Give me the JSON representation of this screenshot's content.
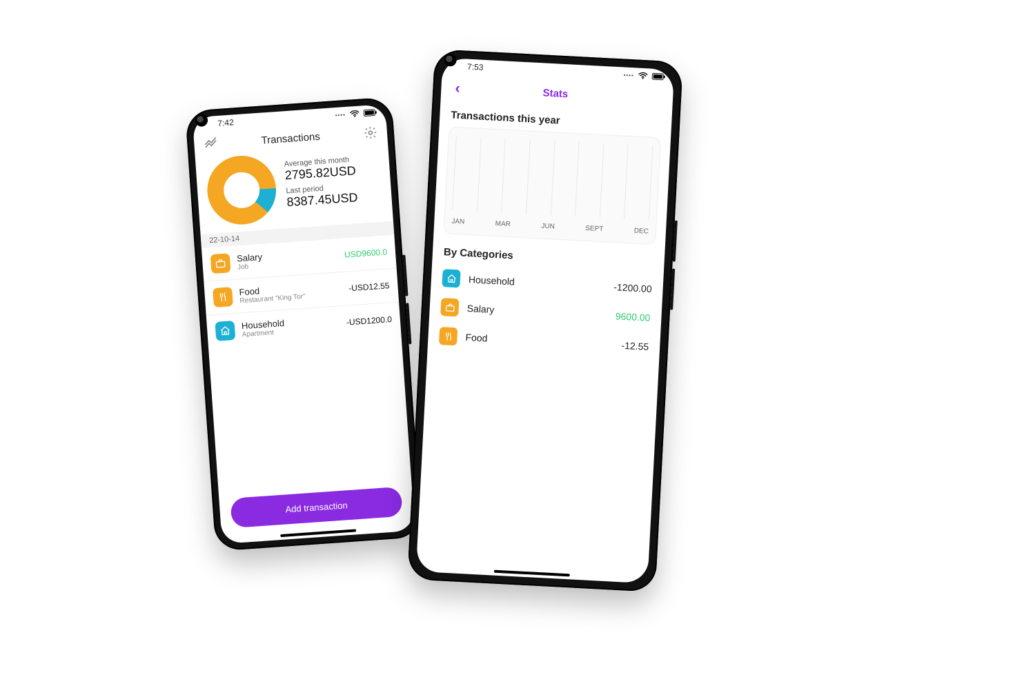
{
  "colors": {
    "purple": "#8a2be2",
    "orange": "#f5a623",
    "cyan": "#1cb0d4",
    "green": "#2ecc71"
  },
  "phone1": {
    "status_time": "7:42",
    "title": "Transactions",
    "summary": {
      "avg_label": "Average this month",
      "avg_value": "2795.82USD",
      "last_label": "Last period",
      "last_value": "8387.45USD"
    },
    "date_header": "22-10-14",
    "transactions": [
      {
        "icon": "briefcase",
        "icon_color": "orange",
        "title": "Salary",
        "subtitle": "Job",
        "amount": "USD9600.0",
        "positive": true
      },
      {
        "icon": "utensils",
        "icon_color": "orange",
        "title": "Food",
        "subtitle": "Restaurant \"King Tor\"",
        "amount": "-USD12.55",
        "positive": false
      },
      {
        "icon": "home",
        "icon_color": "cyan",
        "title": "Household",
        "subtitle": "Apartment",
        "amount": "-USD1200.0",
        "positive": false
      }
    ],
    "cta": "Add transaction"
  },
  "phone2": {
    "status_time": "7:53",
    "title": "Stats",
    "section_year": "Transactions this year",
    "section_cat": "By Categories",
    "categories": [
      {
        "icon": "home",
        "icon_color": "cyan",
        "name": "Household",
        "value": "-1200.00",
        "positive": false
      },
      {
        "icon": "briefcase",
        "icon_color": "orange",
        "name": "Salary",
        "value": "9600.00",
        "positive": true
      },
      {
        "icon": "utensils",
        "icon_color": "orange",
        "name": "Food",
        "value": "-12.55",
        "positive": false
      }
    ]
  },
  "chart_data": {
    "type": "line",
    "title": "Transactions this year",
    "categories": [
      "JAN",
      "MAR",
      "JUN",
      "SEPT",
      "DEC"
    ],
    "series": [
      {
        "name": "Transactions",
        "values": [
          null,
          null,
          null,
          null,
          null
        ]
      }
    ],
    "xlabel": "",
    "ylabel": "",
    "ylim": [
      0,
      0
    ],
    "note": "chart area shown empty in screenshot"
  }
}
